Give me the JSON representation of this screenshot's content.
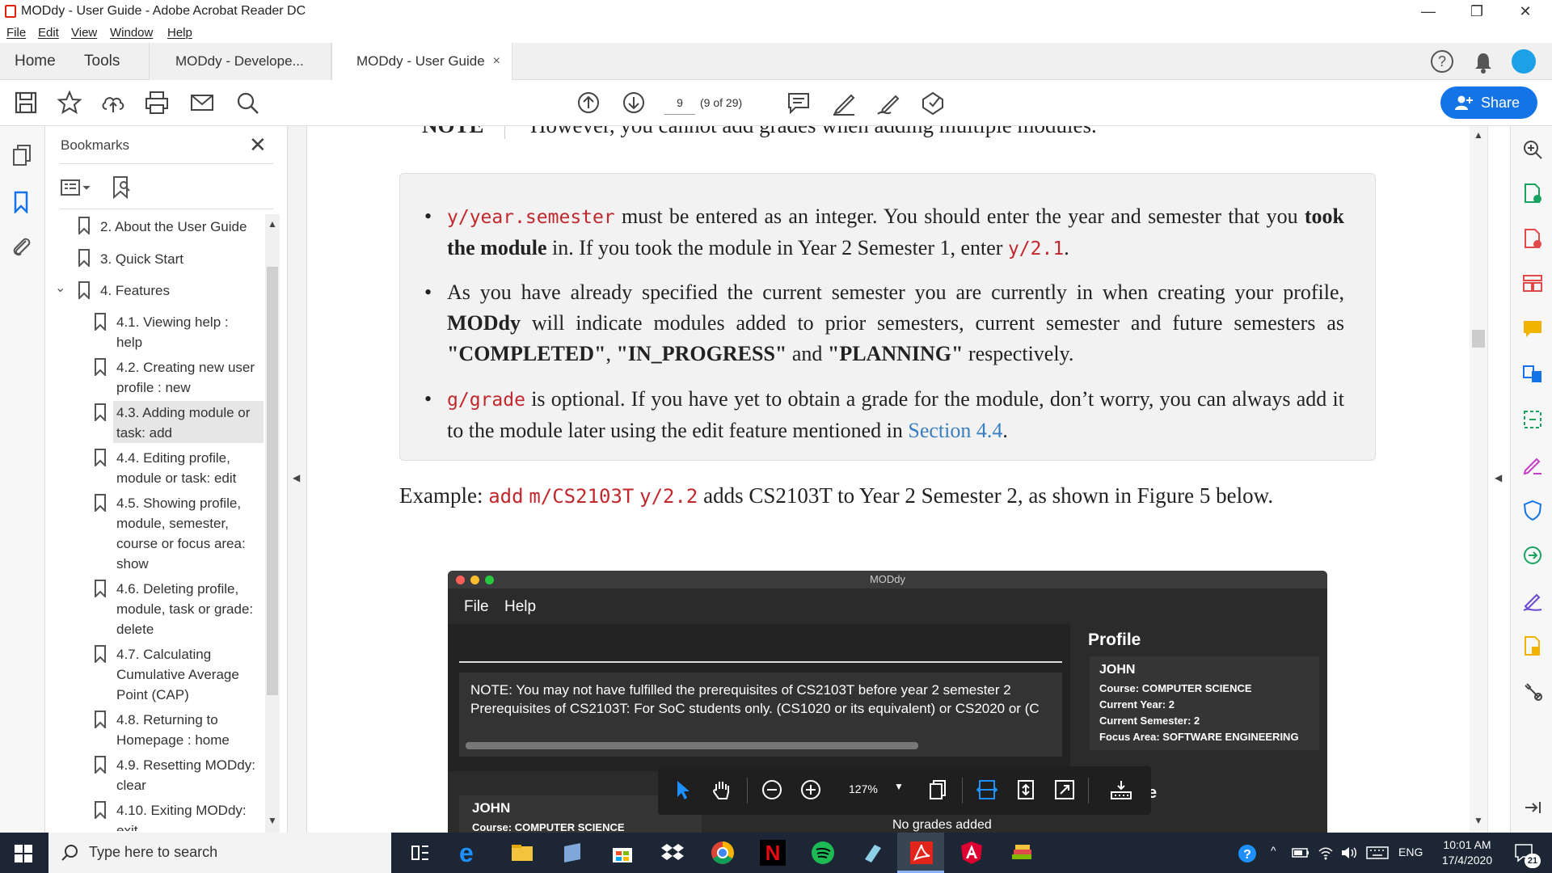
{
  "window": {
    "title": "MODdy - User Guide - Adobe Acrobat Reader DC",
    "minimize": "—",
    "restore": "❐",
    "close": "✕"
  },
  "menu": {
    "items": [
      "File",
      "Edit",
      "View",
      "Window",
      "Help"
    ]
  },
  "tabs": {
    "home": "Home",
    "tools": "Tools",
    "doc1": "MODdy - Develope...",
    "doc2": "MODdy - User Guide",
    "doc2_close": "×"
  },
  "toolbar": {
    "page_number": "9",
    "page_count": "(9 of 29)",
    "share_label": "Share"
  },
  "bookmarks": {
    "title": "Bookmarks",
    "close": "✕",
    "items": [
      {
        "label": "2. About the User Guide"
      },
      {
        "label": "3. Quick Start"
      },
      {
        "label": "4. Features"
      },
      {
        "label1": "4.1. Viewing help :",
        "label2": "help"
      },
      {
        "label1": "4.2. Creating new user",
        "label2": "profile : new"
      },
      {
        "label1": "4.3. Adding module or",
        "label2": "task: add"
      },
      {
        "label1": "4.4. Editing profile,",
        "label2": "module or task: edit"
      },
      {
        "label1": "4.5. Showing profile,",
        "label2": "module, semester,",
        "label3": "course or focus area:",
        "label4": "show"
      },
      {
        "label1": "4.6. Deleting profile,",
        "label2": "module, task or grade:",
        "label3": "delete"
      },
      {
        "label1": "4.7. Calculating",
        "label2": "Cumulative Average",
        "label3": "Point (CAP)"
      },
      {
        "label1": "4.8. Returning to",
        "label2": "Homepage : home"
      },
      {
        "label1": "4.9. Resetting MODdy:",
        "label2": "clear"
      },
      {
        "label1": "4.10. Exiting MODdy:",
        "label2": "exit"
      }
    ]
  },
  "document": {
    "top_note_label": "NOTE",
    "top_note_text": "However, you cannot add grades when adding multiple modules.",
    "bullet1": {
      "code1": "y/year.semester",
      "t1": " must be entered as an integer. You should enter the year and semester that you ",
      "bold": "took the module",
      "t2": " in. If you took the module in Year 2 Semester 1, enter ",
      "code2": "y/2.1",
      "t3": "."
    },
    "bullet2": {
      "t1": "As you have already specified the current semester you are currently in when creating your profile, ",
      "bold1": "MODdy",
      "t2": " will indicate modules added to prior semesters, current semester and future semesters as ",
      "bold2": "\"COMPLETED\"",
      "t3": ", ",
      "bold3": "\"IN_PROGRESS\"",
      "t4": " and ",
      "bold4": "\"PLANNING\"",
      "t5": " respectively."
    },
    "bullet3": {
      "code1": "g/grade",
      "t1": " is optional. If you have yet to obtain a grade for the module, don’t worry, you can always add it to the module later using the edit feature mentioned in ",
      "link": "Section 4.4",
      "t2": "."
    },
    "example": {
      "t1": "Example: ",
      "code1": "add",
      "code2": "m/CS2103T",
      "code3": "y/2.2",
      "t2": " adds CS2103T to Year 2 Semester 2, as shown in Figure 5 below."
    }
  },
  "screenshot": {
    "title": "MODdy",
    "menu_file": "File",
    "menu_help": "Help",
    "note_line1": "NOTE: You may not have fulfilled the prerequisites of CS2103T before year 2 semester 2",
    "note_line2": "Prerequisites of CS2103T: For SoC students only. (CS1020 or its equivalent) or CS2020 or (C",
    "profile_title": "Profile",
    "profile_name": "JOHN",
    "profile_course": "Course: COMPUTER SCIENCE",
    "profile_year": "Current Year: 2",
    "profile_sem": "Current Semester: 2",
    "profile_focus": "Focus Area: SOFTWARE ENGINEERING",
    "lower_name": "JOHN",
    "lower_course": "Course: COMPUTER SCIENCE",
    "lower_grades": "No grades added",
    "lower_right": "e"
  },
  "floatbar": {
    "zoom": "127%"
  },
  "taskbar": {
    "search_placeholder": "Type here to search",
    "lang": "ENG",
    "time": "10:01 AM",
    "date": "17/4/2020",
    "notif_count": "21"
  },
  "colors": {
    "accent": "#1473e6",
    "code_red": "#c0282d",
    "link_blue": "#3a7fc1",
    "taskbar": "#1c2634"
  }
}
